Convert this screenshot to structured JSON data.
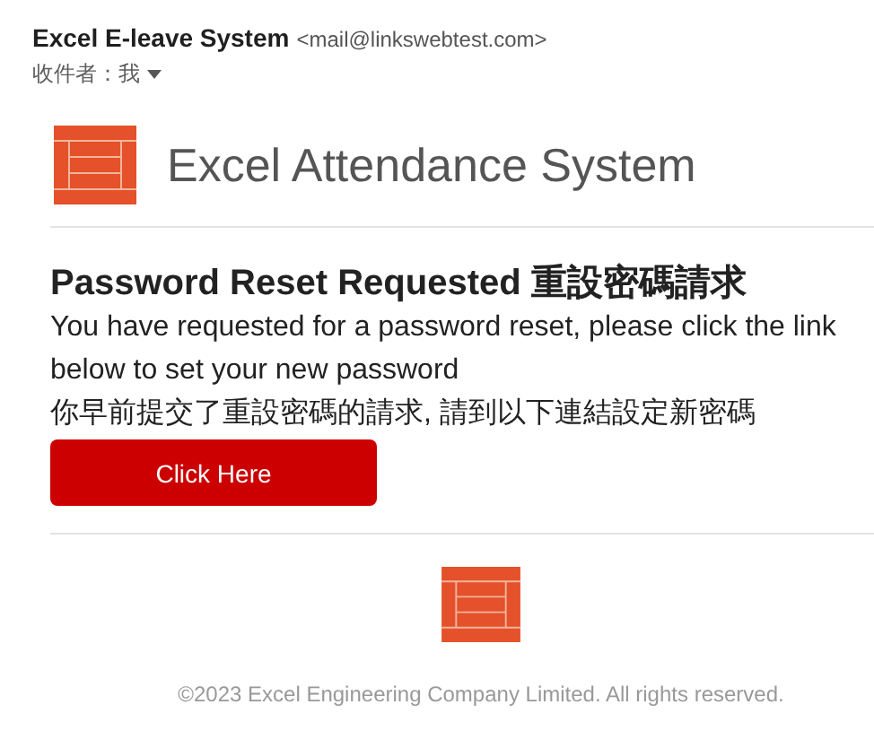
{
  "email": {
    "sender_name": "Excel E-leave System",
    "sender_address": "<mail@linkswebtest.com>",
    "recipient": "收件者：我"
  },
  "header": {
    "title": "Excel Attendance System"
  },
  "body": {
    "heading": "Password Reset Requested 重設密碼請求",
    "message": "You have requested for a password reset, please click the link below to set your new password",
    "message_zh": "你早前提交了重設密碼的請求, 請到以下連結設定新密碼",
    "button": "Click Here"
  },
  "footer": {
    "copyright": "©2023 Excel Engineering Company Limited. All rights reserved."
  }
}
